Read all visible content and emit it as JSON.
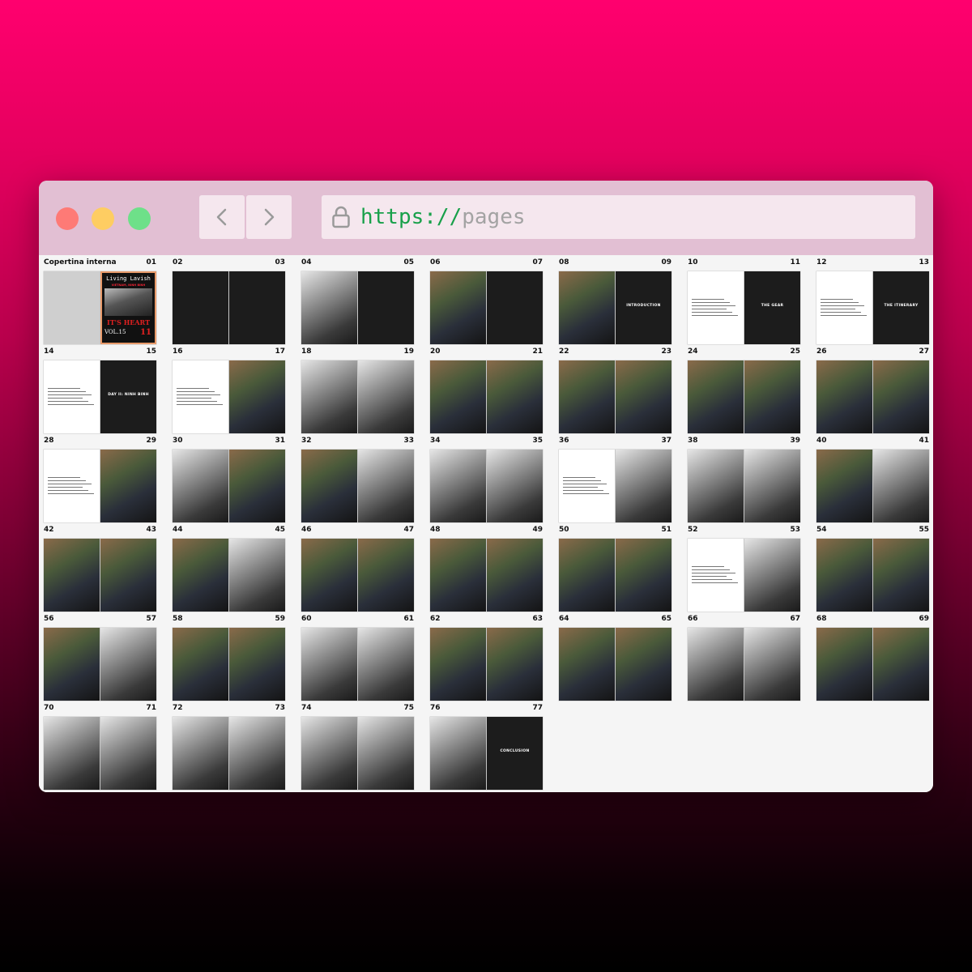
{
  "browser": {
    "url_scheme": "https://",
    "url_path": "pages",
    "back_icon": "chevron-left-icon",
    "forward_icon": "chevron-right-icon",
    "lock_icon": "lock-icon"
  },
  "colors": {
    "background_top": "#ff006e",
    "background_bottom": "#000000",
    "chrome": "#e2bfd3",
    "scheme_green": "#18a04a"
  },
  "cover": {
    "label": "Copertina interna",
    "number": "01",
    "title": "Living Lavish",
    "subtitle": "VIETNAM, NINH BINH",
    "headline": "IT'S HEART",
    "volume": "VOL.15",
    "issue": "11"
  },
  "spreads": [
    {
      "left": "02",
      "right": "03",
      "pages": [
        "black",
        "black"
      ]
    },
    {
      "left": "04",
      "right": "05",
      "pages": [
        "photo-bw",
        "black"
      ]
    },
    {
      "left": "06",
      "right": "07",
      "pages": [
        "photo-color",
        "black"
      ]
    },
    {
      "left": "08",
      "right": "09",
      "pages": [
        "photo-color",
        "black-title"
      ],
      "title": "INTRODUCTION"
    },
    {
      "left": "10",
      "right": "11",
      "pages": [
        "white-text",
        "black-title"
      ],
      "title": "THE GEAR"
    },
    {
      "left": "12",
      "right": "13",
      "pages": [
        "white-text",
        "black-title"
      ],
      "title": "THE ITINERARY"
    },
    {
      "left": "14",
      "right": "15",
      "pages": [
        "white-text",
        "black-title"
      ],
      "title": "DAY II: NINH BINH"
    },
    {
      "left": "16",
      "right": "17",
      "pages": [
        "white-text",
        "photo-color"
      ]
    },
    {
      "left": "18",
      "right": "19",
      "pages": [
        "photo-bw",
        "photo-bw"
      ]
    },
    {
      "left": "20",
      "right": "21",
      "pages": [
        "photo-color",
        "photo-color"
      ]
    },
    {
      "left": "22",
      "right": "23",
      "pages": [
        "photo-color",
        "photo-color"
      ]
    },
    {
      "left": "24",
      "right": "25",
      "pages": [
        "photo-color",
        "photo-color"
      ]
    },
    {
      "left": "26",
      "right": "27",
      "pages": [
        "photo-color",
        "photo-color"
      ]
    },
    {
      "left": "28",
      "right": "29",
      "pages": [
        "white-text",
        "photo-color"
      ]
    },
    {
      "left": "30",
      "right": "31",
      "pages": [
        "photo-bw",
        "photo-color"
      ]
    },
    {
      "left": "32",
      "right": "33",
      "pages": [
        "photo-color",
        "photo-bw"
      ]
    },
    {
      "left": "34",
      "right": "35",
      "pages": [
        "photo-bw",
        "photo-bw"
      ]
    },
    {
      "left": "36",
      "right": "37",
      "pages": [
        "white-text",
        "photo-bw"
      ]
    },
    {
      "left": "38",
      "right": "39",
      "pages": [
        "photo-bw",
        "photo-bw"
      ]
    },
    {
      "left": "40",
      "right": "41",
      "pages": [
        "photo-color",
        "photo-bw"
      ]
    },
    {
      "left": "42",
      "right": "43",
      "pages": [
        "photo-color",
        "photo-color"
      ]
    },
    {
      "left": "44",
      "right": "45",
      "pages": [
        "photo-color",
        "photo-bw"
      ]
    },
    {
      "left": "46",
      "right": "47",
      "pages": [
        "photo-color",
        "photo-color"
      ]
    },
    {
      "left": "48",
      "right": "49",
      "pages": [
        "photo-color",
        "photo-color"
      ]
    },
    {
      "left": "50",
      "right": "51",
      "pages": [
        "photo-color",
        "photo-color"
      ]
    },
    {
      "left": "52",
      "right": "53",
      "pages": [
        "white-text",
        "photo-bw"
      ]
    },
    {
      "left": "54",
      "right": "55",
      "pages": [
        "photo-color",
        "photo-color"
      ]
    },
    {
      "left": "56",
      "right": "57",
      "pages": [
        "photo-color",
        "photo-bw"
      ]
    },
    {
      "left": "58",
      "right": "59",
      "pages": [
        "photo-color",
        "photo-color"
      ]
    },
    {
      "left": "60",
      "right": "61",
      "pages": [
        "photo-bw",
        "photo-bw"
      ]
    },
    {
      "left": "62",
      "right": "63",
      "pages": [
        "photo-color",
        "photo-color"
      ]
    },
    {
      "left": "64",
      "right": "65",
      "pages": [
        "photo-color",
        "photo-color"
      ]
    },
    {
      "left": "66",
      "right": "67",
      "pages": [
        "photo-bw",
        "photo-bw"
      ]
    },
    {
      "left": "68",
      "right": "69",
      "pages": [
        "photo-color",
        "photo-color"
      ]
    },
    {
      "left": "70",
      "right": "71",
      "pages": [
        "photo-bw",
        "photo-bw"
      ]
    },
    {
      "left": "72",
      "right": "73",
      "pages": [
        "photo-bw",
        "photo-bw"
      ]
    },
    {
      "left": "74",
      "right": "75",
      "pages": [
        "photo-bw",
        "photo-bw"
      ]
    },
    {
      "left": "76",
      "right": "77",
      "pages": [
        "photo-bw",
        "black-title"
      ],
      "title": "CONCLUSION"
    }
  ]
}
